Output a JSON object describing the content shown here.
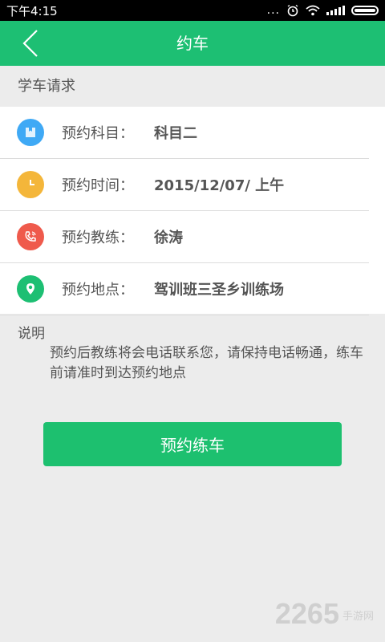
{
  "status_bar": {
    "time": "下午4:15",
    "dots": "..."
  },
  "app_bar": {
    "title": "约车"
  },
  "section": {
    "title": "学车请求"
  },
  "details": [
    {
      "label": "预约科目：",
      "value": "科目二",
      "icon": "book-icon",
      "color": "#3fa9f5"
    },
    {
      "label": "预约时间：",
      "value": "2015/12/07/ 上午",
      "icon": "clock-icon",
      "color": "#f4b63a"
    },
    {
      "label": "预约教练：",
      "value": "徐涛",
      "icon": "phone-icon",
      "color": "#ef5a4c"
    },
    {
      "label": "预约地点：",
      "value": "驾训班三圣乡训练场",
      "icon": "location-pin-icon",
      "color": "#1dbf73"
    }
  ],
  "notes": {
    "title": "说明",
    "text": "预约后教练将会电话联系您，请保持电话畅通，练车前请准时到达预约地点"
  },
  "actions": {
    "book_label": "预约练车"
  },
  "watermark": {
    "number": "2265",
    "text": "手游网"
  },
  "colors": {
    "accent": "#1dbf73",
    "status_bar": "#000000",
    "background": "#ececec"
  }
}
